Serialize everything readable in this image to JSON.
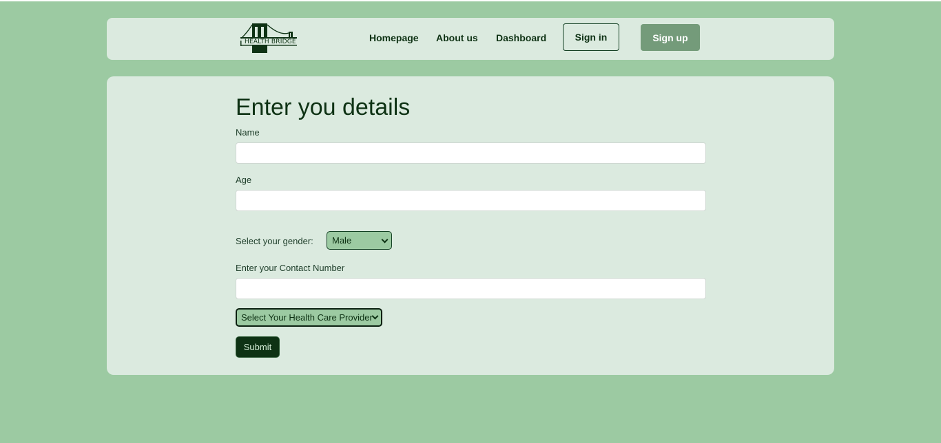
{
  "header": {
    "logo_text": "HEALTH BRIDGE",
    "nav": {
      "homepage": "Homepage",
      "about": "About us",
      "dashboard": "Dashboard"
    },
    "signin_label": "Sign in",
    "signup_label": "Sign up"
  },
  "form": {
    "title": "Enter you details",
    "name_label": "Name",
    "name_value": "",
    "age_label": "Age",
    "age_value": "",
    "gender_label": "Select your gender:",
    "gender_selected": "Male",
    "contact_label": "Enter your Contact Number",
    "contact_value": "",
    "provider_selected": "Select Your Health Care Provider",
    "submit_label": "Submit"
  },
  "colors": {
    "page_bg": "#9ccaa2",
    "panel_bg": "#dbeadf",
    "dark_green": "#0e3214",
    "signup_bg": "#749b7a"
  },
  "icons": {
    "logo": "bridge-logo-icon",
    "select_arrow": "chevron-down-icon"
  }
}
